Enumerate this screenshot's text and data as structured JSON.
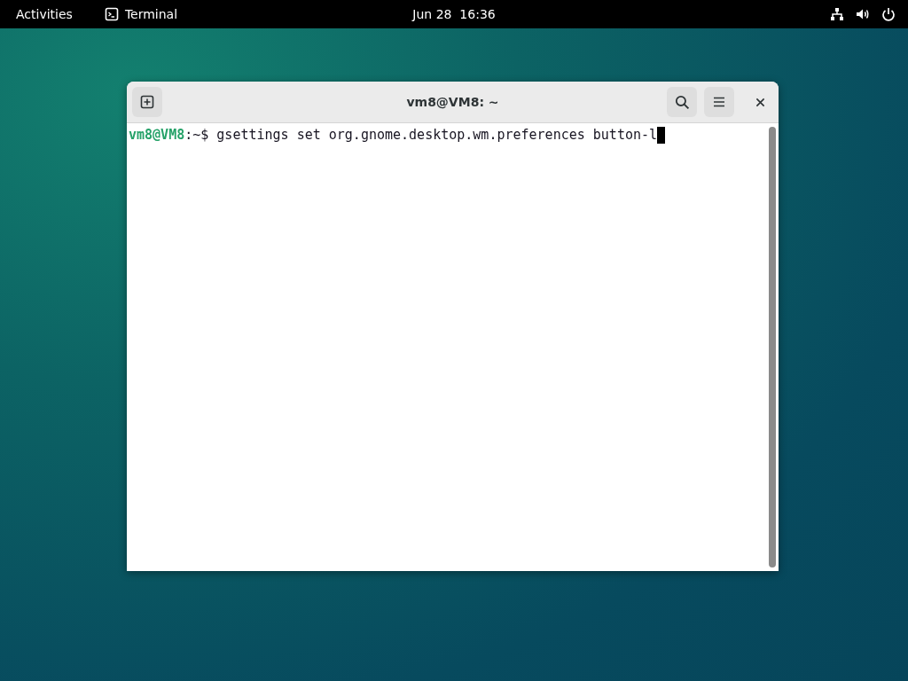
{
  "top_bar": {
    "activities": "Activities",
    "app_name": "Terminal",
    "clock": "Jun 28  16:36"
  },
  "window": {
    "title": "vm8@VM8: ~",
    "terminal": {
      "lines": [
        {
          "user_host": "vm8@VM8",
          "path": ":~$ ",
          "command": "gsettings set org.gnome.desktop.wm.preferences button-l",
          "cursor": true
        }
      ]
    }
  }
}
